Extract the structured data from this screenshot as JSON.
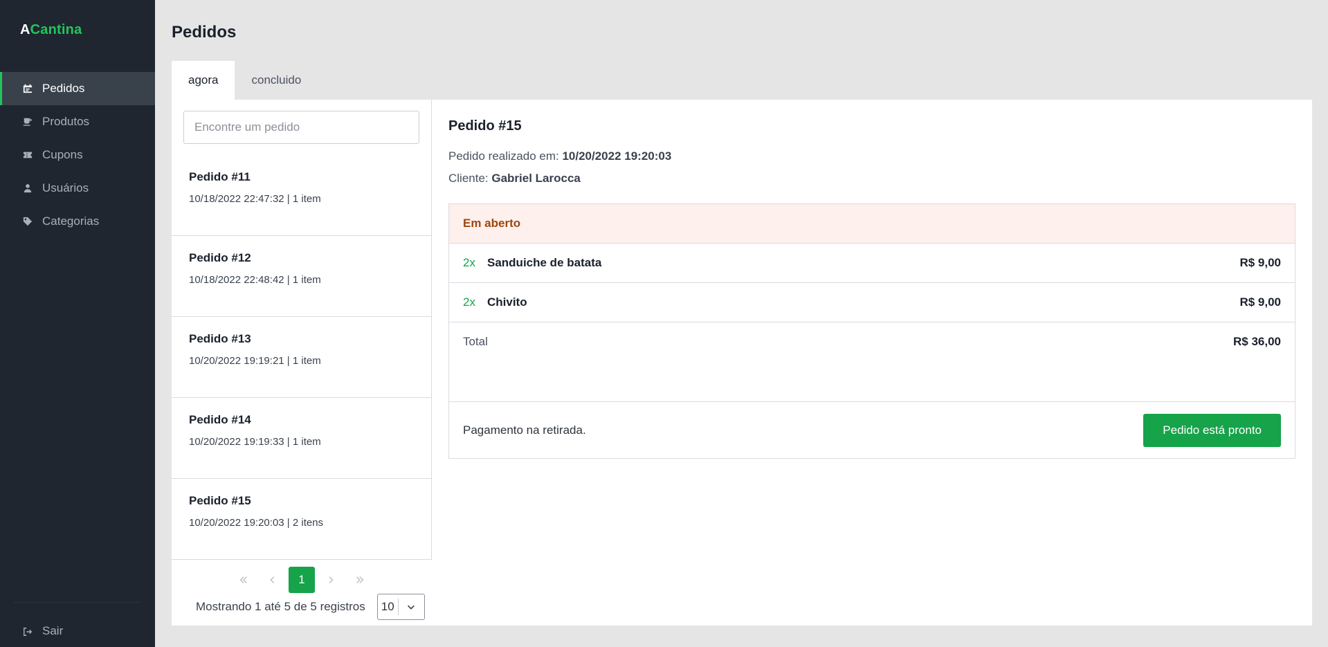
{
  "app": {
    "logo_first": "A",
    "logo_rest": "Cantina"
  },
  "sidebar": {
    "items": [
      {
        "label": "Pedidos",
        "icon": "calendar-icon",
        "active": true
      },
      {
        "label": "Produtos",
        "icon": "coffee-icon",
        "active": false
      },
      {
        "label": "Cupons",
        "icon": "ticket-icon",
        "active": false
      },
      {
        "label": "Usuários",
        "icon": "user-icon",
        "active": false
      },
      {
        "label": "Categorias",
        "icon": "tag-icon",
        "active": false
      }
    ],
    "logout_label": "Sair"
  },
  "page": {
    "title": "Pedidos"
  },
  "tabs": [
    {
      "label": "agora",
      "active": true
    },
    {
      "label": "concluido",
      "active": false
    }
  ],
  "search": {
    "placeholder": "Encontre um pedido",
    "value": ""
  },
  "orders": [
    {
      "title": "Pedido #11",
      "meta": "10/18/2022 22:47:32 | 1 item"
    },
    {
      "title": "Pedido #12",
      "meta": "10/18/2022 22:48:42 | 1 item"
    },
    {
      "title": "Pedido #13",
      "meta": "10/20/2022 19:19:21 | 1 item"
    },
    {
      "title": "Pedido #14",
      "meta": "10/20/2022 19:19:33 | 1 item"
    },
    {
      "title": "Pedido #15",
      "meta": "10/20/2022 19:20:03 | 2 itens"
    }
  ],
  "pagination": {
    "current_page": "1",
    "records_text": "Mostrando 1 até 5 de 5 registros",
    "page_size": "10"
  },
  "detail": {
    "title": "Pedido #15",
    "placed_label": "Pedido realizado em:",
    "placed_value": "10/20/2022 19:20:03",
    "client_label": "Cliente:",
    "client_value": "Gabriel Larocca",
    "status": "Em aberto",
    "items": [
      {
        "qty": "2x",
        "name": "Sanduiche de batata",
        "price": "R$ 9,00"
      },
      {
        "qty": "2x",
        "name": "Chivito",
        "price": "R$ 9,00"
      }
    ],
    "total_label": "Total",
    "total_value": "R$ 36,00",
    "payment_note": "Pagamento na retirada.",
    "ready_button": "Pedido está pronto"
  },
  "colors": {
    "sidebar_bg": "#1f262f",
    "accent": "#22c55e",
    "primary_button": "#16a34a",
    "status_bg": "#fef0ec",
    "status_text": "#a0450f"
  }
}
